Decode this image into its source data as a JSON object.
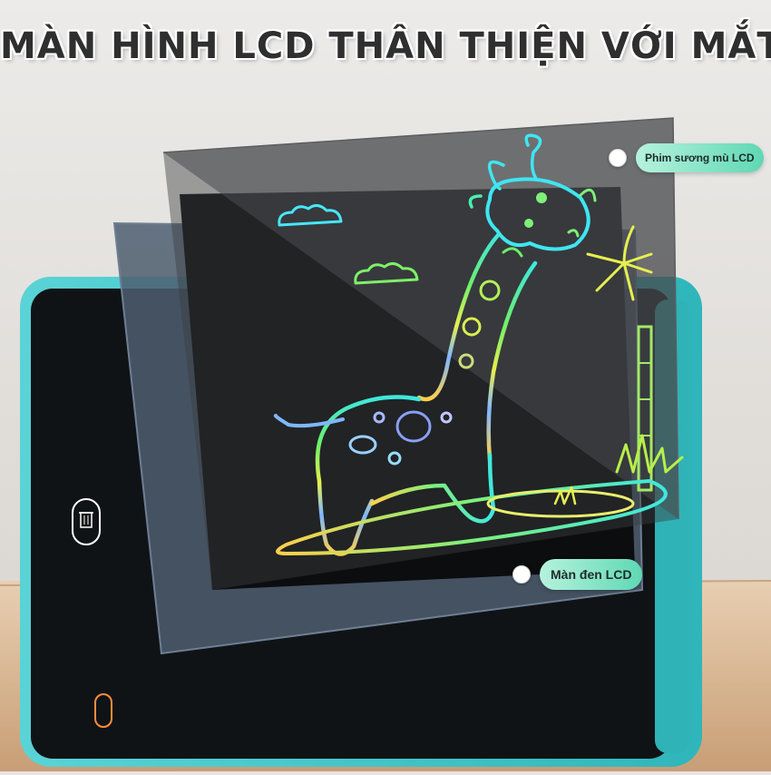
{
  "title": "MÀN HÌNH LCD THÂN THIỆN VỚI MẮT",
  "callouts": {
    "film": "Phim sương mù LCD",
    "screen": "Màn đen LCD"
  },
  "colors": {
    "tablet_frame": "#3fc6c9",
    "screen": "#15181c",
    "callout_pill": "#5fd8b3",
    "wall": "#e7e4e1",
    "table": "#d9b58f"
  },
  "icons": [
    "trash-icon",
    "lock-icon"
  ]
}
